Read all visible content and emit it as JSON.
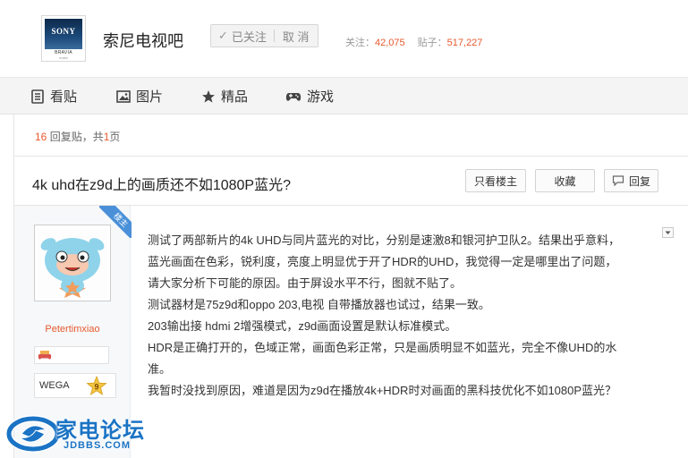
{
  "forum": {
    "logo_brand": "SONY",
    "logo_product": "BRAVIA",
    "logo_sub": "make",
    "title": "索尼电视吧",
    "follow_label": "已关注",
    "cancel_label": "取 消",
    "follow_stat_label": "关注：",
    "follow_count": "42,075",
    "post_stat_label": "贴子：",
    "post_count": "517,227"
  },
  "nav": {
    "items": [
      {
        "label": "看贴",
        "icon": "document-icon"
      },
      {
        "label": "图片",
        "icon": "image-icon"
      },
      {
        "label": "精品",
        "icon": "star-icon"
      },
      {
        "label": "游戏",
        "icon": "gamepad-icon"
      }
    ]
  },
  "thread": {
    "reply_count": "16",
    "reply_suffix": " 回复贴，共",
    "page_count": "1",
    "page_suffix": "页",
    "title": "4k uhd在z9d上的画质还不如1080P蓝光?",
    "only_op_label": "只看楼主",
    "favorite_label": "收藏",
    "reply_label": "回复"
  },
  "post": {
    "ribbon_label": "楼主",
    "author": "Petertimxiao",
    "badge_name": "WEGA",
    "badge_level": "9",
    "lines": [
      "测试了两部新片的4k UHD与同片蓝光的对比，分别是速激8和银河护卫队2。结果出乎意料，",
      "蓝光画面在色彩，锐利度，亮度上明显优于开了HDR的UHD，我觉得一定是哪里出了问题，",
      "请大家分析下可能的原因。由于屏设水平不行，图就不贴了。",
      "测试器材是75z9d和oppo 203,电视 自带播放器也试过，结果一致。",
      "203输出接 hdmi 2增强模式，z9d画面设置是默认标准模式。",
      "HDR是正确打开的，色域正常，画面色彩正常，只是画质明显不如蓝光，完全不像UHD的水",
      "准。",
      "我暂时没找到原因，难道是因为z9d在播放4k+HDR时对画面的黑科技优化不如1080P蓝光？"
    ]
  },
  "watermark": {
    "cn": "家电论坛",
    "en": "JDBBS.COM"
  },
  "colors": {
    "accent_orange": "#e65a2e",
    "ribbon_blue": "#4a90d9",
    "watermark_blue": "#1a73c4",
    "nav_bg": "#f4f4f4"
  }
}
